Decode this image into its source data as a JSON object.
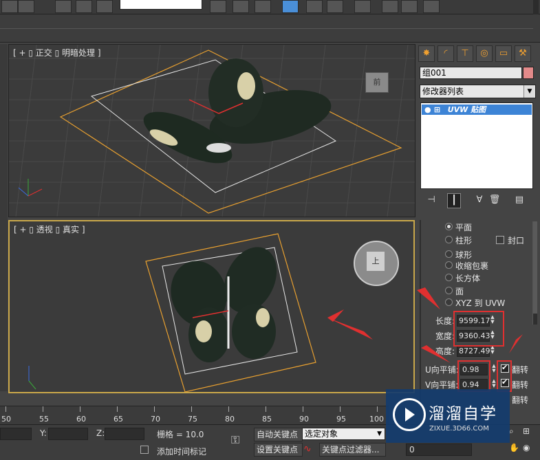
{
  "toolbar": {
    "buttons": [
      "snap-2d",
      "snap-angle",
      "snap-percent",
      "snap-spinner",
      "named-selection",
      "mirror",
      "align",
      "layer",
      "curve-editor",
      "schematic",
      "material-editor",
      "render-setup",
      "render",
      "rendered-frame"
    ]
  },
  "viewports": {
    "top": {
      "label": "[ + ▯ 正交 ▯ 明暗处理 ]",
      "viewcube_face": "前"
    },
    "perspective": {
      "label": "[ + ▯ 透视 ▯ 真实 ]",
      "viewcube_face": "上"
    }
  },
  "command_panel": {
    "tabs": [
      "create-icon",
      "modify-icon",
      "hierarchy-icon",
      "motion-icon",
      "display-icon",
      "utilities-icon"
    ],
    "object_name": "组001",
    "object_color": "#e38a8a",
    "modifier_list": "修改器列表",
    "stack_item": "UVW 贴图"
  },
  "uvw": {
    "mapping_options": [
      {
        "label": "平面",
        "selected": true
      },
      {
        "label": "柱形",
        "selected": false
      },
      {
        "label": "球形",
        "selected": false
      },
      {
        "label": "收缩包裹",
        "selected": false
      },
      {
        "label": "长方体",
        "selected": false
      },
      {
        "label": "面",
        "selected": false
      },
      {
        "label": "XYZ 到 UVW",
        "selected": false
      }
    ],
    "cap_label": "封口",
    "length_label": "长度:",
    "length_value": "9599.17",
    "width_label": "宽度:",
    "width_value": "9360.43",
    "height_label": "高度:",
    "height_value": "8727.49",
    "u_tile_label": "U向平铺:",
    "u_tile_value": "0.98",
    "v_tile_label": "V向平铺:",
    "v_tile_value": "0.94",
    "flip_label": "翻转"
  },
  "timeline": {
    "ticks": [
      "50",
      "55",
      "60",
      "65",
      "70",
      "75",
      "80",
      "85",
      "90",
      "95",
      "100"
    ]
  },
  "bottom": {
    "y_label": "Y:",
    "z_label": "Z:",
    "grid": "栅格 = 10.0",
    "auto_key": "自动关键点",
    "selected_object": "选定对象",
    "set_key": "设置关键点",
    "key_filters": "关键点过滤器...",
    "add_time_tag": "添加时间标记",
    "frame_value": "0"
  },
  "watermark": {
    "title": "溜溜自学",
    "url": "ZIXUE.3D66.COM"
  }
}
